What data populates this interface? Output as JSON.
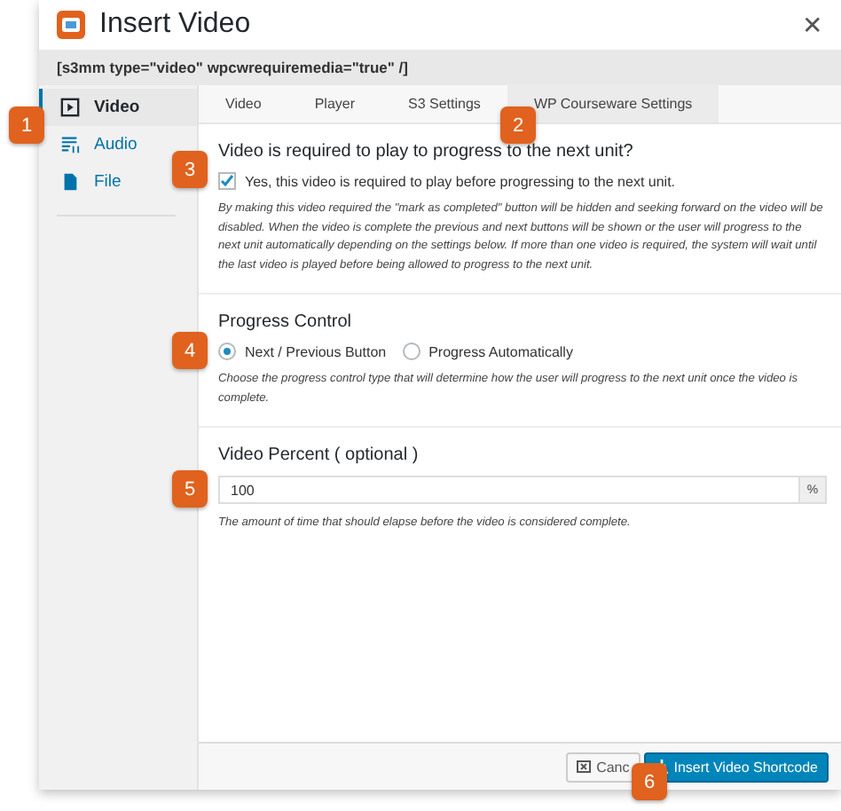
{
  "window": {
    "title": "Insert Video",
    "close": "✕"
  },
  "shortcode": "[s3mm type=\"video\" wpcwrequiremedia=\"true\" /]",
  "sidebar": {
    "items": [
      {
        "label": "Video",
        "selected": true
      },
      {
        "label": "Audio",
        "selected": false
      },
      {
        "label": "File",
        "selected": false
      }
    ]
  },
  "tabs": [
    {
      "label": "Video",
      "selected": false
    },
    {
      "label": "Player",
      "selected": false
    },
    {
      "label": "S3 Settings",
      "selected": false
    },
    {
      "label": "WP Courseware Settings",
      "selected": true
    }
  ],
  "sections": [
    {
      "kind": "checkbox",
      "heading": "Video is required to play to progress to the next unit?",
      "options": [
        {
          "label": "Yes, this video is required to play before progressing to the next unit.",
          "checked": true
        }
      ],
      "help": "By making this video required the \"mark as completed\" button will be hidden and seeking forward on the video will be disabled. When the video is complete the previous and next buttons will be shown or the user will progress to the next unit automatically depending on the settings below. If more than one video is required, the system will wait until the last video is played before being allowed to progress to the next unit."
    },
    {
      "kind": "radio",
      "heading": "Progress Control",
      "options": [
        {
          "label": "Next / Previous Button",
          "selected": true
        },
        {
          "label": "Progress Automatically",
          "selected": false
        }
      ],
      "help": "Choose the progress control type that will determine how the user will progress to the next unit once the video is complete."
    },
    {
      "kind": "input",
      "heading": "Video Percent ( optional )",
      "value": "100",
      "suffix": "%",
      "help": "The amount of time that should elapse before the video is considered complete."
    }
  ],
  "buttons": [
    {
      "label": "Canc",
      "kind": "secondary"
    },
    {
      "label": "Insert Video Shortcode",
      "kind": "primary"
    }
  ],
  "callouts": [
    "1",
    "2",
    "3",
    "4",
    "5",
    "6"
  ]
}
